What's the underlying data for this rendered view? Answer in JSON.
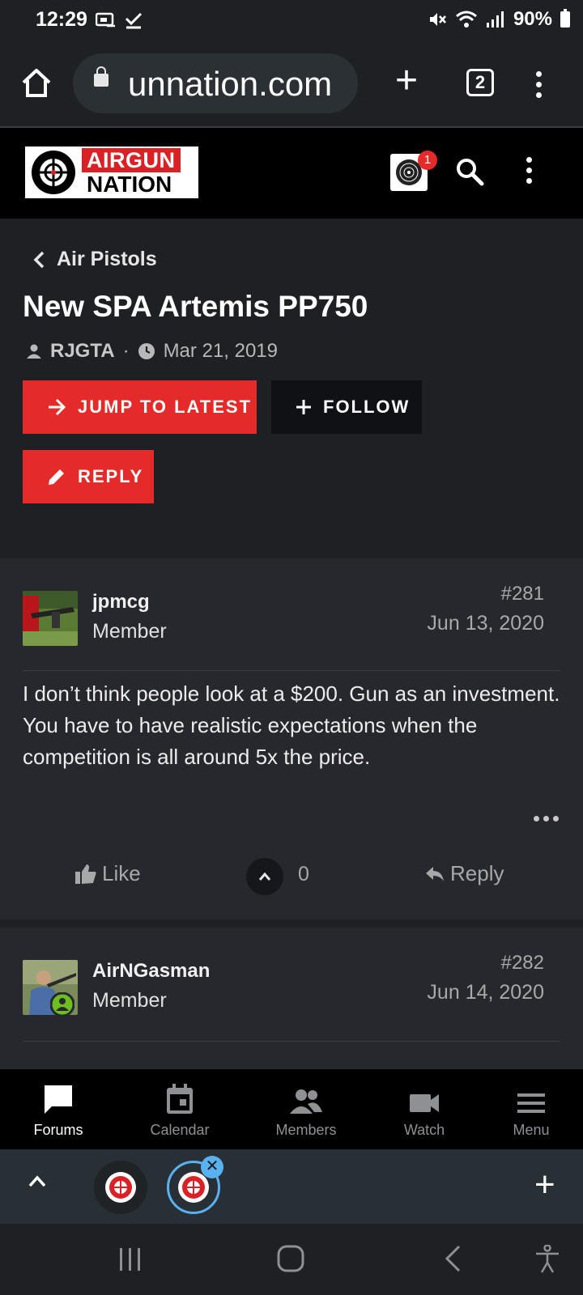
{
  "status_bar": {
    "time": "12:29",
    "battery": "90%"
  },
  "browser": {
    "url": "unnation.com",
    "tab_count": "2"
  },
  "site": {
    "logo_line1": "AIRGUN",
    "logo_line2": "NATION",
    "notification_count": "1"
  },
  "thread": {
    "breadcrumb": "Air Pistols",
    "title": "New SPA Artemis PP750",
    "author": "RJGTA",
    "separator": "·",
    "date": "Mar 21, 2019",
    "jump_label": "JUMP TO LATEST",
    "follow_label": "FOLLOW",
    "reply_label": "REPLY"
  },
  "posts": [
    {
      "username": "jpmcg",
      "role": "Member",
      "number": "#281",
      "date": "Jun 13, 2020",
      "body": "I don’t think people look at a $200. Gun as an investment. You have to have realistic expectations when the competition is all around 5x the price.",
      "like_label": "Like",
      "vote_count": "0",
      "reply_label": "Reply"
    },
    {
      "username": "AirNGasman",
      "role": "Member",
      "number": "#282",
      "date": "Jun 14, 2020"
    }
  ],
  "bottom_nav": {
    "items": [
      {
        "label": "Forums",
        "icon": "chat-bubble-icon"
      },
      {
        "label": "Calendar",
        "icon": "calendar-icon"
      },
      {
        "label": "Members",
        "icon": "members-icon"
      },
      {
        "label": "Watch",
        "icon": "video-camera-icon"
      },
      {
        "label": "Menu",
        "icon": "hamburger-menu-icon"
      }
    ],
    "active": "Forums"
  },
  "colors": {
    "accent_red": "#e52a2a",
    "background": "#1f2024",
    "post_background": "#27282d",
    "online_green": "#6dbf1f",
    "tab_highlight": "#5ab1ef"
  }
}
